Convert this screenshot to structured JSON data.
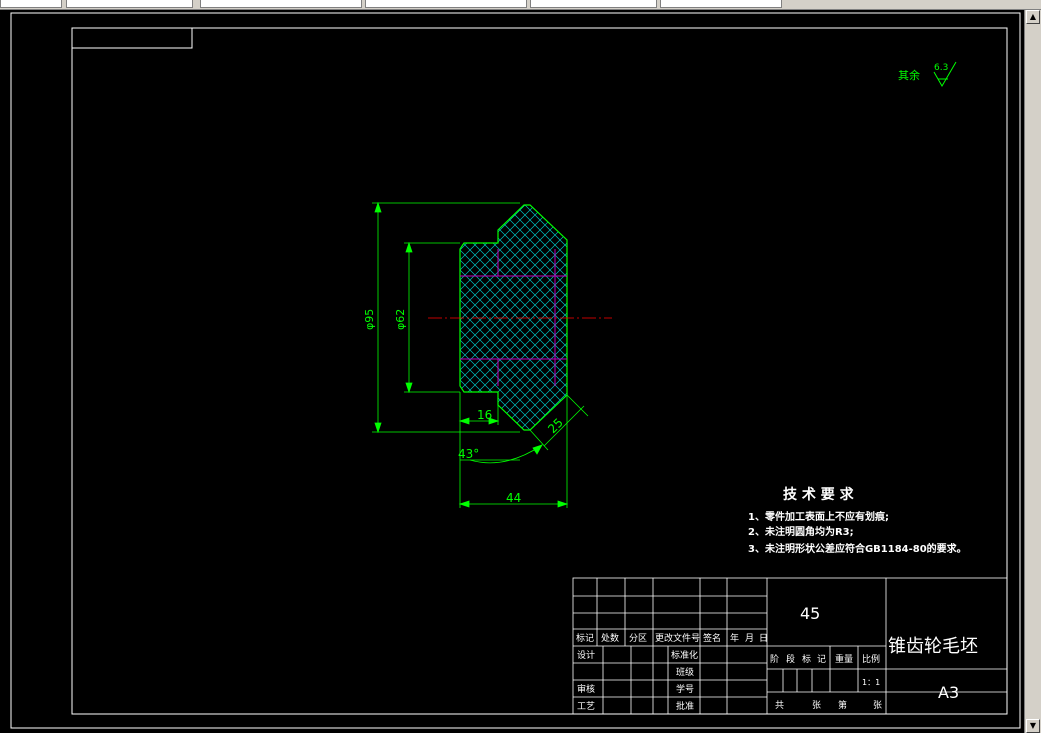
{
  "app": {
    "toolbar_fields": [
      "",
      "",
      "",
      "",
      ""
    ]
  },
  "drawing": {
    "surface_finish": {
      "label": "其余",
      "value": "6.3"
    },
    "dimensions": {
      "outer_diameter": "φ95",
      "inner_diameter": "φ62",
      "hub_width": "16",
      "chamfer": "25",
      "angle": "43°",
      "total_width": "44"
    },
    "tech_requirements": {
      "title": "技 术 要 求",
      "items": [
        "1、零件加工表面上不应有划痕;",
        "2、未注明圆角均为R3;",
        "3、未注明形状公差应符合GB1184-80的要求。"
      ]
    },
    "title_block": {
      "material": "45",
      "part_name": "锥齿轮毛坯",
      "sheet_size": "A3",
      "scale": "1：1",
      "headers": [
        "标记",
        "处数",
        "分区",
        "更改文件号",
        "签名",
        "年",
        "月",
        "日"
      ],
      "roles": [
        "设计",
        "审核",
        "工艺"
      ],
      "std_labels": [
        "标准化",
        "班级",
        "学号",
        "批准"
      ],
      "stage_labels": [
        "阶",
        "段",
        "标",
        "记"
      ],
      "weight_label": "重量",
      "scale_label": "比例",
      "sheets_labels": [
        "共",
        "张",
        "第",
        "张"
      ]
    }
  },
  "colors": {
    "part_outline": "#00ff00",
    "hatch": "#c000c0",
    "center_line": "#ff0000",
    "frame": "#ffffff"
  }
}
